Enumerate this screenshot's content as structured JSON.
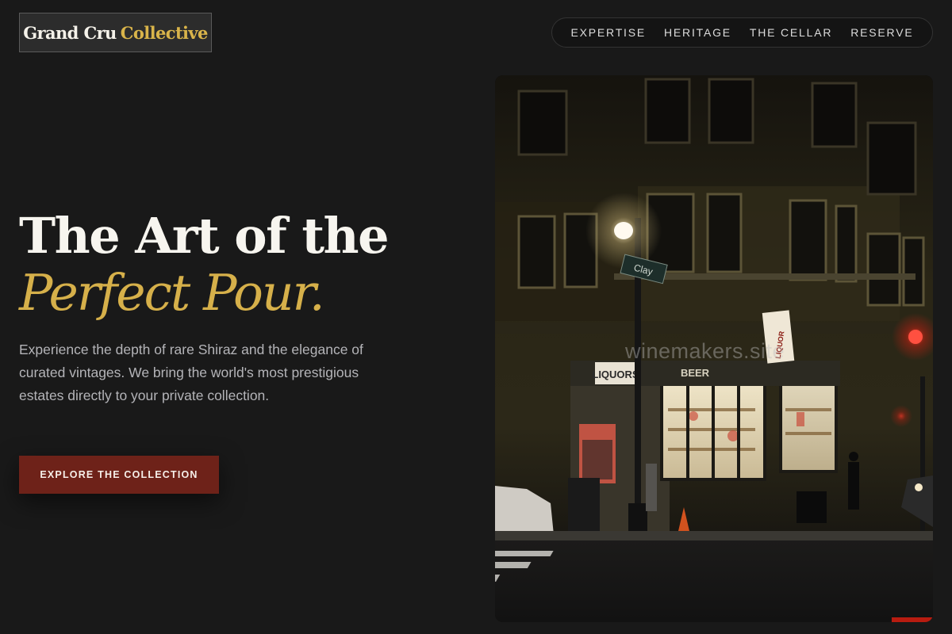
{
  "brand": {
    "word1": "Grand Cru",
    "word2": "Collective"
  },
  "nav": {
    "items": [
      "EXPERTISE",
      "HERITAGE",
      "THE CELLAR",
      "RESERVE"
    ]
  },
  "hero": {
    "title_line1": "The Art of the",
    "title_line2": "Perfect Pour.",
    "body": "Experience the depth of rare Shiraz and the elegance of curated vintages. We bring the world's most prestigious estates directly to your private collection.",
    "cta_label": "EXPLORE THE COLLECTION"
  },
  "photo": {
    "watermark": "winemakers.site",
    "signs": {
      "liquors": "LIQUORS",
      "beer": "BEER",
      "liquor_vertical": "LIQUOR",
      "street": "Clay"
    }
  },
  "colors": {
    "background": "#191919",
    "accent_gold": "#d6b04a",
    "cta_red": "#6e2219",
    "body_text": "#b4b4b8"
  }
}
